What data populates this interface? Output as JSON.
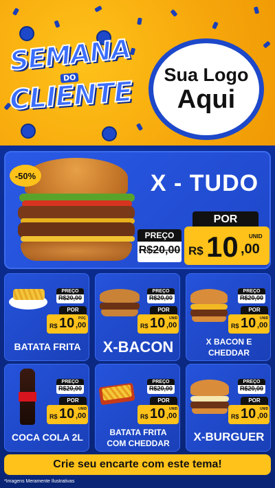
{
  "header": {
    "title_line1": "SEMANA",
    "title_line2": "DO",
    "title_line3": "CLIENTE",
    "logo_line1": "Sua Logo",
    "logo_line2": "Aqui"
  },
  "hero": {
    "discount": "-50%",
    "name": "X - TUDO",
    "preco_label": "PREÇO",
    "old_price": "R$20,00",
    "por_label": "POR",
    "currency": "R$",
    "price_int": "10",
    "price_dec": ",00",
    "unit": "UNID"
  },
  "cards": [
    {
      "name": "BATATA FRITA",
      "preco_label": "PREÇO",
      "old_price": "R$20,00",
      "por_label": "POR",
      "currency": "R$",
      "price_int": "10",
      "price_dec": ",00",
      "unit": "POÇ"
    },
    {
      "name": "X-BACON",
      "preco_label": "PREÇO",
      "old_price": "R$20,00",
      "por_label": "POR",
      "currency": "R$",
      "price_int": "10",
      "price_dec": ",00",
      "unit": "UNID"
    },
    {
      "name_line1": "X BACON E",
      "name_line2": "CHEDDAR",
      "preco_label": "PREÇO",
      "old_price": "R$20,00",
      "por_label": "POR",
      "currency": "R$",
      "price_int": "10",
      "price_dec": ",00",
      "unit": "UNID"
    },
    {
      "name": "COCA COLA 2L",
      "preco_label": "PREÇO",
      "old_price": "R$20,00",
      "por_label": "POR",
      "currency": "R$",
      "price_int": "10",
      "price_dec": ",00",
      "unit": "UNID"
    },
    {
      "name_line1": "BATATA FRITA",
      "name_line2": "COM CHEDDAR",
      "preco_label": "PREÇO",
      "old_price": "R$20,00",
      "por_label": "POR",
      "currency": "R$",
      "price_int": "10",
      "price_dec": ",00",
      "unit": "UNID"
    },
    {
      "name": "X-BURGUER",
      "preco_label": "PREÇO",
      "old_price": "R$20,00",
      "por_label": "POR",
      "currency": "R$",
      "price_int": "10",
      "price_dec": ",00",
      "unit": "UNID"
    }
  ],
  "footer": {
    "cta": "Crie seu encarte com este tema!",
    "disclaimer": "*Imagens Meramente Ilustrativas"
  },
  "colors": {
    "accent_yellow": "#ffc21a",
    "brand_blue": "#1d48c9",
    "dark_blue": "#0a2575"
  }
}
